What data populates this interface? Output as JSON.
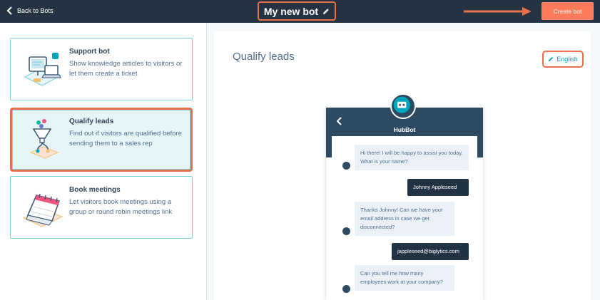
{
  "topbar": {
    "back_label": "Back to Bots",
    "bot_name": "My new bot",
    "create_label": "Create bot"
  },
  "bot_types": [
    {
      "title": "Support bot",
      "description": "Show knowledge articles to visitors or let them create a ticket"
    },
    {
      "title": "Qualify leads",
      "description": "Find out if visitors are qualified before sending them to a sales rep"
    },
    {
      "title": "Book meetings",
      "description": "Let visitors book meetings using a group or round robin meetings link"
    }
  ],
  "preview": {
    "title": "Qualify leads",
    "language_label": "English",
    "chat": {
      "bot_name": "HubBot",
      "messages": [
        {
          "from": "bot",
          "text": "Hi there! I will be happy to assist you today. What is your name?"
        },
        {
          "from": "user",
          "text": "Johnny Appleseed"
        },
        {
          "from": "bot",
          "text": "Thanks Johnny! Can we have your email address in case we get disconnected?"
        },
        {
          "from": "user",
          "text": "jappleseed@biglytics.com"
        },
        {
          "from": "bot",
          "text": "Can you tell me how many employees work at your company?"
        }
      ]
    }
  },
  "colors": {
    "topbar": "#253342",
    "accent": "#ff7a59",
    "highlight": "#e8704c",
    "teal": "#00a4bd",
    "card_border": "#7fd1de"
  }
}
